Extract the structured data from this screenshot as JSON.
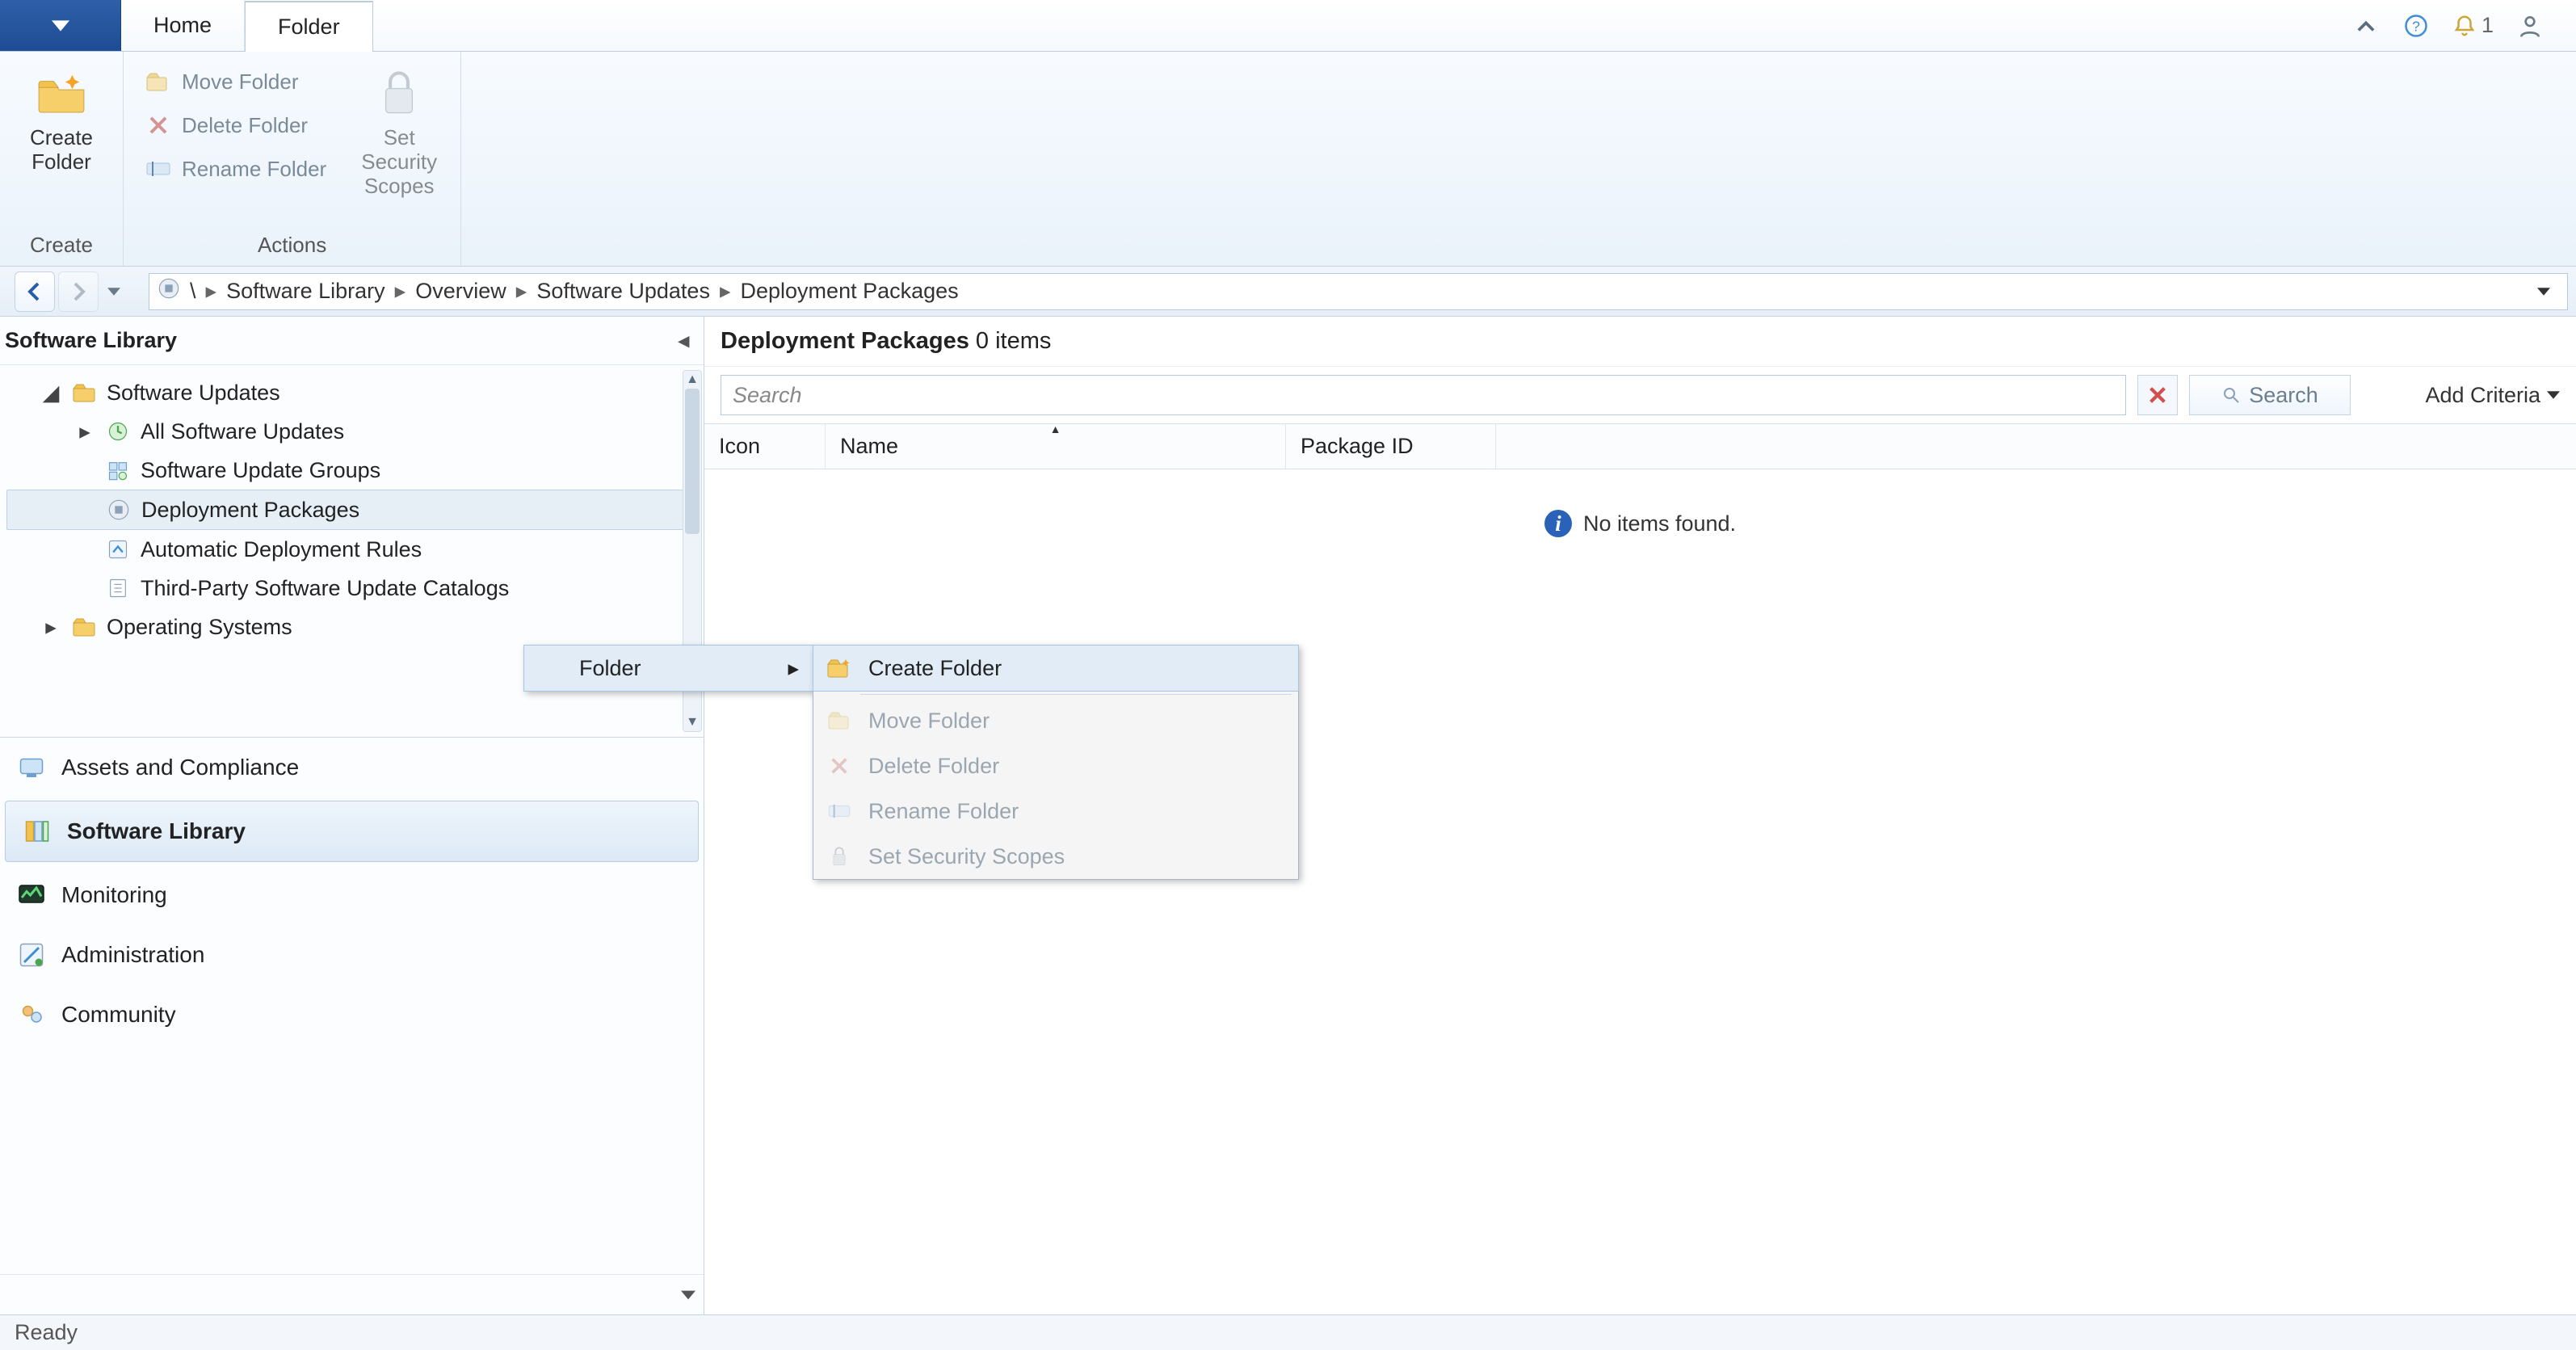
{
  "tabs": {
    "home": "Home",
    "folder": "Folder"
  },
  "notif_count": "1",
  "ribbon": {
    "create_folder": "Create\nFolder",
    "create_group": "Create",
    "move_folder": "Move Folder",
    "delete_folder": "Delete Folder",
    "rename_folder": "Rename Folder",
    "set_security": "Set Security\nScopes",
    "actions_group": "Actions"
  },
  "breadcrumb": {
    "root": "\\",
    "items": [
      "Software Library",
      "Overview",
      "Software Updates",
      "Deployment Packages"
    ]
  },
  "sidebar": {
    "title": "Software Library",
    "tree": {
      "software_updates": "Software Updates",
      "all_updates": "All Software Updates",
      "update_groups": "Software Update Groups",
      "deployment_packages": "Deployment Packages",
      "adr": "Automatic Deployment Rules",
      "third_party": "Third-Party Software Update Catalogs",
      "operating_systems": "Operating Systems"
    }
  },
  "wunderbar": {
    "assets": "Assets and Compliance",
    "library": "Software Library",
    "monitoring": "Monitoring",
    "administration": "Administration",
    "community": "Community"
  },
  "content": {
    "title": "Deployment Packages",
    "count_suffix": "0 items",
    "search_placeholder": "Search",
    "search_btn": "Search",
    "add_criteria": "Add Criteria",
    "cols": {
      "icon": "Icon",
      "name": "Name",
      "pkg": "Package ID"
    },
    "empty": "No items found."
  },
  "context": {
    "folder": "Folder",
    "create": "Create Folder",
    "move": "Move Folder",
    "delete": "Delete Folder",
    "rename": "Rename Folder",
    "scopes": "Set Security Scopes"
  },
  "status": "Ready"
}
